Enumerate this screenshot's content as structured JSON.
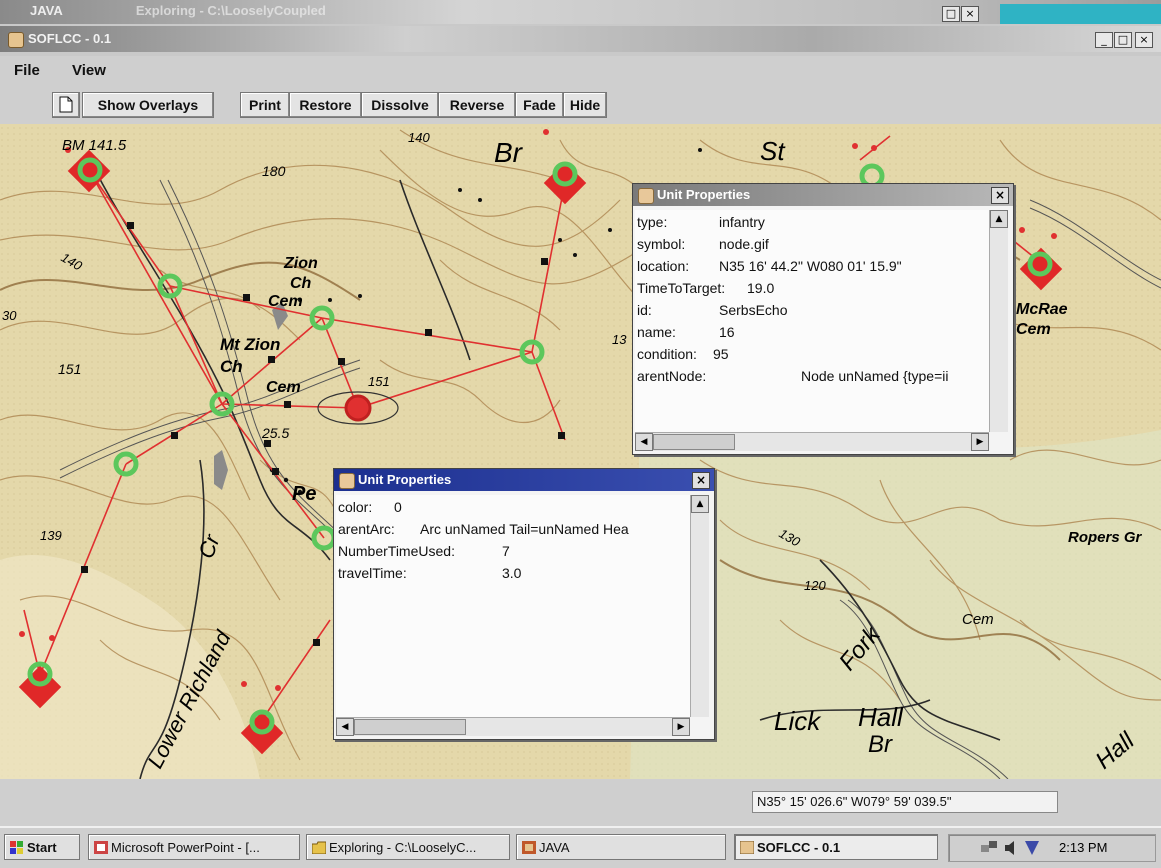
{
  "background_window": {
    "title": "JAVA",
    "title2": "Exploring - C:\\LooselyCoupled"
  },
  "window": {
    "title": "SOFLCC - 0.1",
    "min_label": "_",
    "max_label": "□",
    "close_label": "×"
  },
  "menu": {
    "file": "File",
    "view": "View"
  },
  "toolbar": {
    "new_icon": "document-icon",
    "show_overlays": "Show Overlays",
    "print": "Print",
    "restore": "Restore",
    "dissolve": "Dissolve",
    "reverse": "Reverse",
    "fade": "Fade",
    "hide": "Hide"
  },
  "map": {
    "labels": {
      "bm": "BM 141.5",
      "n180": "180",
      "n140a": "140",
      "n140b": "140",
      "br_top": "Br",
      "st": "St",
      "zion": "Zion",
      "ch1": "Ch",
      "cem1": "Cem",
      "mtzion": "Mt Zion",
      "ch2": "Ch",
      "cem2": "Cem",
      "n151a": "151",
      "n151b": "151",
      "n137": "13",
      "n255": "25.5",
      "pe": "Pe",
      "n139": "139",
      "lower_richland": "Lower Richland",
      "cr": "Cr",
      "mcrae": "McRae",
      "cem_mcrae": "Cem",
      "ropers": "Ropers Gr",
      "n130": "130",
      "n120": "120",
      "cem3": "Cem",
      "fork": "Fork",
      "lick": "Lick",
      "hall": "Hall",
      "br_bottom": "Br",
      "hall_right": "Hall",
      "n30": "30"
    }
  },
  "dialog1": {
    "title": "Unit Properties",
    "rows": [
      {
        "key": "type:",
        "value": "infantry"
      },
      {
        "key": "symbol:",
        "value": "node.gif"
      },
      {
        "key": "location:",
        "value": "N35 16' 44.2\" W080 01' 15.9\""
      },
      {
        "key": "TimeToTarget:",
        "value": "19.0"
      },
      {
        "key": "id:",
        "value": "SerbsEcho"
      },
      {
        "key": "name:",
        "value": "16"
      },
      {
        "key": "condition:",
        "value": "95"
      },
      {
        "key": "arentNode:",
        "value": "Node unNamed {type=ii"
      }
    ]
  },
  "dialog2": {
    "title": "Unit Properties",
    "rows": [
      {
        "key": "color:",
        "value": "0"
      },
      {
        "key": "arentArc:",
        "value": "Arc unNamed Tail=unNamed Hea"
      },
      {
        "key": "NumberTimeUsed:",
        "value": "7"
      },
      {
        "key": "travelTime:",
        "value": "3.0"
      }
    ]
  },
  "status": {
    "coordinates": "N35° 15' 026.6\"  W079° 59' 039.5\""
  },
  "taskbar": {
    "start": "Start",
    "tasks": [
      "Microsoft PowerPoint - [...",
      "Exploring - C:\\LooselyC...",
      "JAVA",
      "SOFLCC - 0.1"
    ],
    "clock": "2:13 PM"
  },
  "colors": {
    "route": "#e03030",
    "node_ring": "#5cc75c",
    "target": "#e02828",
    "titlebar_active": "#1c2f8f"
  }
}
